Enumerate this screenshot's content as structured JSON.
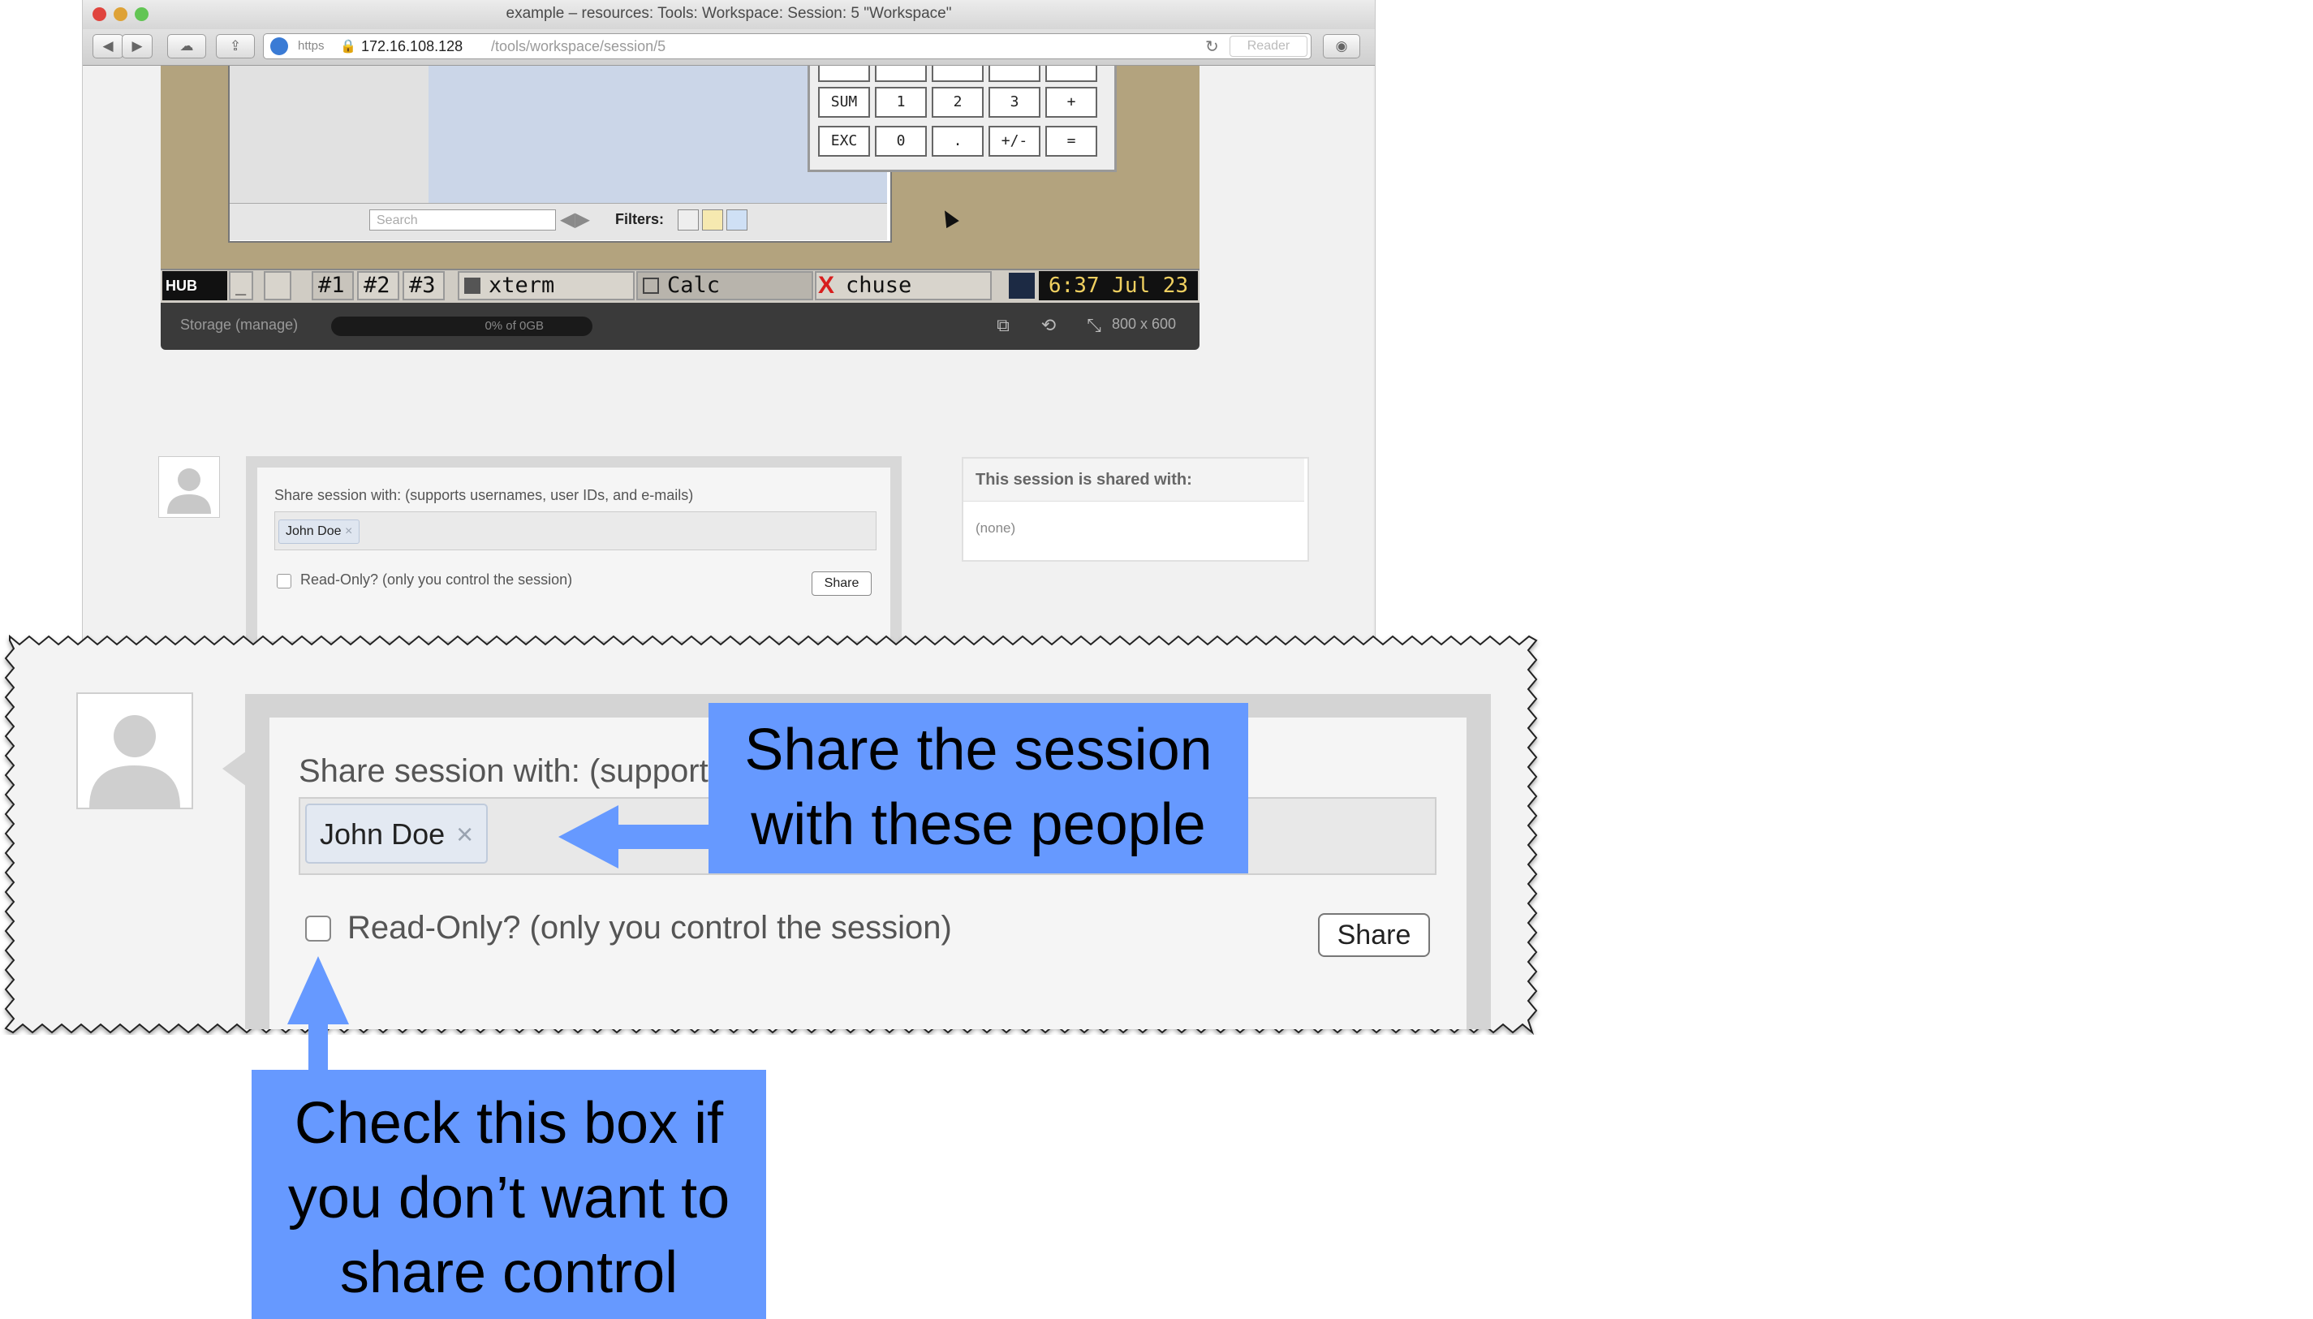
{
  "browser": {
    "title": "example – resources: Tools: Workspace: Session: 5 \"Workspace\"",
    "url_host": "172.16.108.128",
    "url_path": "/tools/workspace/session/5",
    "https_label": "https",
    "reader_label": "Reader"
  },
  "desktop": {
    "search_placeholder": "Search",
    "filters_label": "Filters:",
    "calculator_keys": [
      [
        "SUM",
        "1",
        "2",
        "3",
        "+"
      ],
      [
        "EXC",
        "0",
        ".",
        "+/-",
        "="
      ]
    ],
    "taskbar": {
      "hub_label": "HUB",
      "workspaces": [
        "#1",
        "#2",
        "#3"
      ],
      "tasks": [
        "xterm",
        "Calc",
        "chuse"
      ],
      "clock": "6:37 Jul 23"
    },
    "storage_label": "Storage (manage)",
    "storage_usage": "0% of 0GB",
    "storage_fraction": 0,
    "resolution": "800 x 600"
  },
  "share": {
    "prompt": "Share session with: (supports usernames, user IDs, and e-mails)",
    "prompt_zoomed": "Share session with: (support",
    "token": "John Doe",
    "token_remove": "×",
    "readonly_label": "Read-Only? (only you control the session)",
    "readonly_checked": false,
    "button_label": "Share"
  },
  "shared_with": {
    "title": "This session is shared with:",
    "none_label": "(none)"
  },
  "annotations": {
    "share_line1": "Share the session",
    "share_line2": "with these people",
    "check_line1": "Check this box if",
    "check_line2": "you don’t want to",
    "check_line3": "share control"
  },
  "colors": {
    "callout": "#6699ff",
    "desktop": "#b3a37e"
  }
}
